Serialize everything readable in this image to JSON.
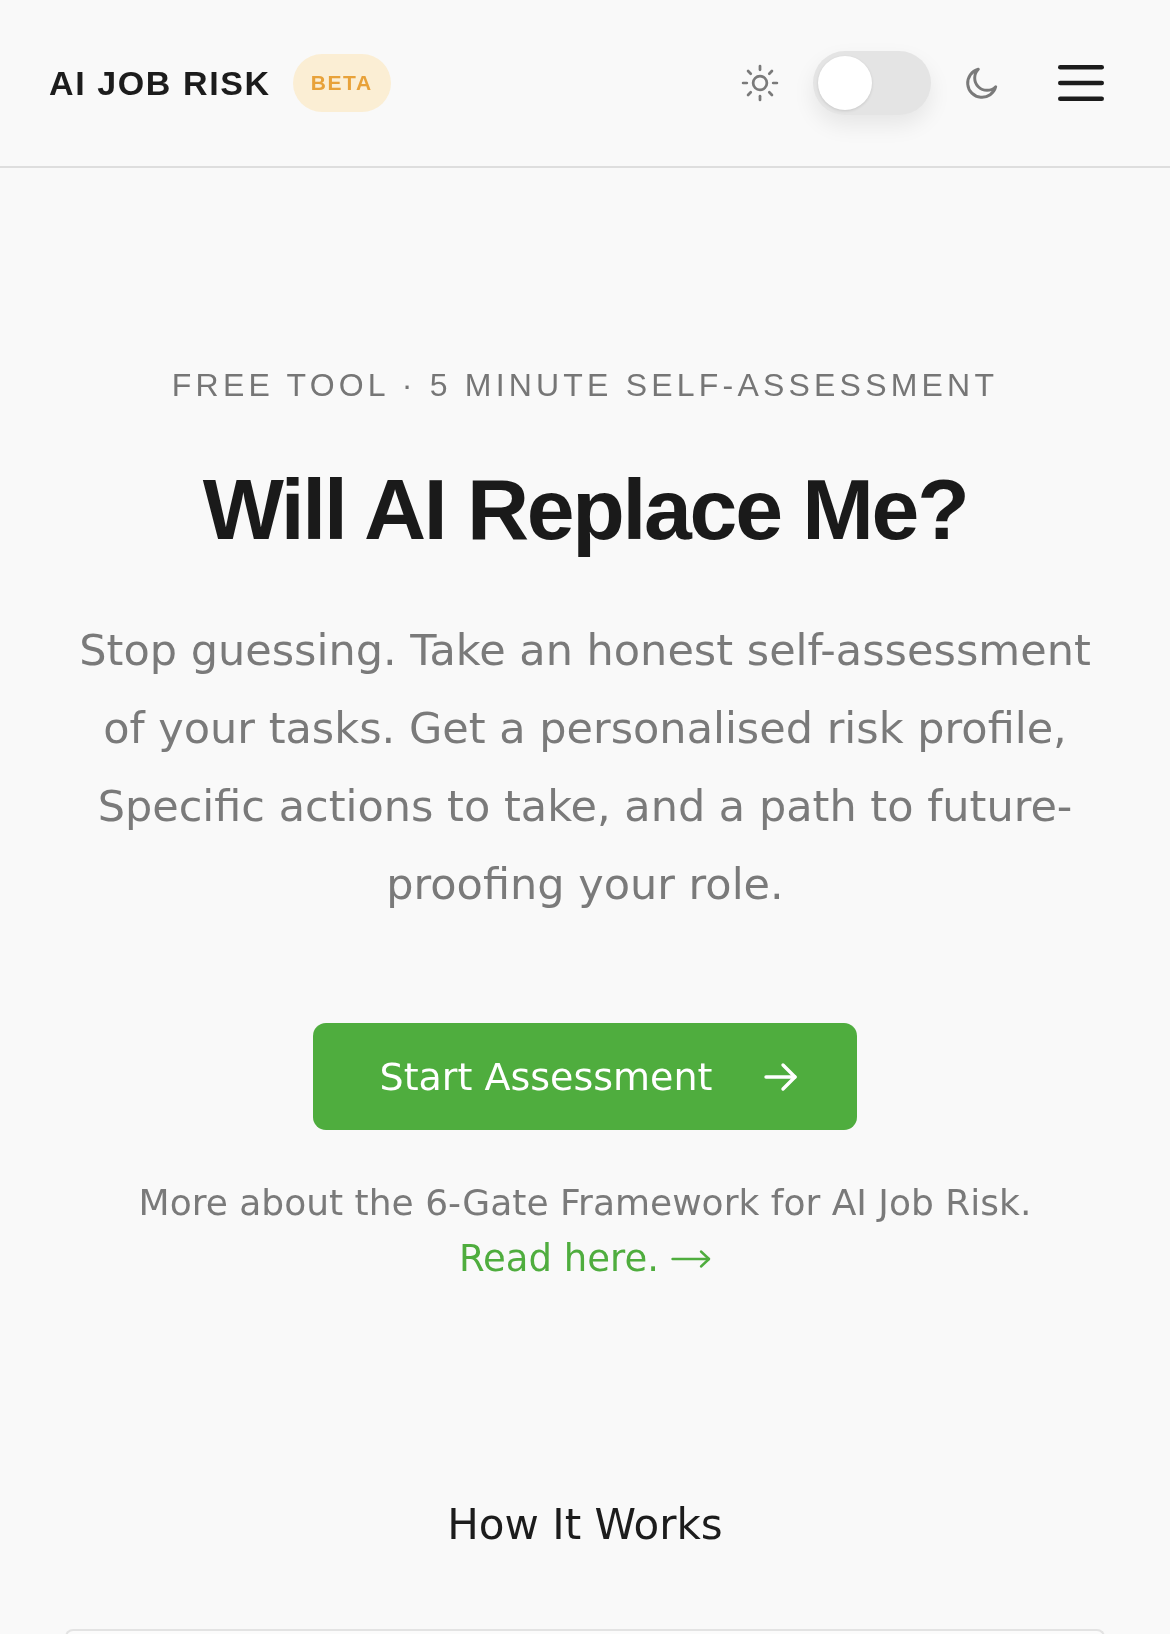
{
  "header": {
    "logo": "AI JOB RISK",
    "badge": "BETA",
    "theme_toggle": {
      "dark_mode": false
    }
  },
  "hero": {
    "eyebrow": "FREE TOOL · 5 MINUTE SELF-ASSESSMENT",
    "title": "Will AI Replace Me?",
    "description": "Stop guessing. Take an honest self-assessment of your tasks. Get a personalised risk profile, Specific actions to take, and a path to future-proofing your role.",
    "cta": "Start Assessment",
    "framework_note": "More about the 6-Gate Framework for AI Job Risk.",
    "framework_link": "Read here."
  },
  "how_it_works": {
    "title": "How It Works"
  }
}
